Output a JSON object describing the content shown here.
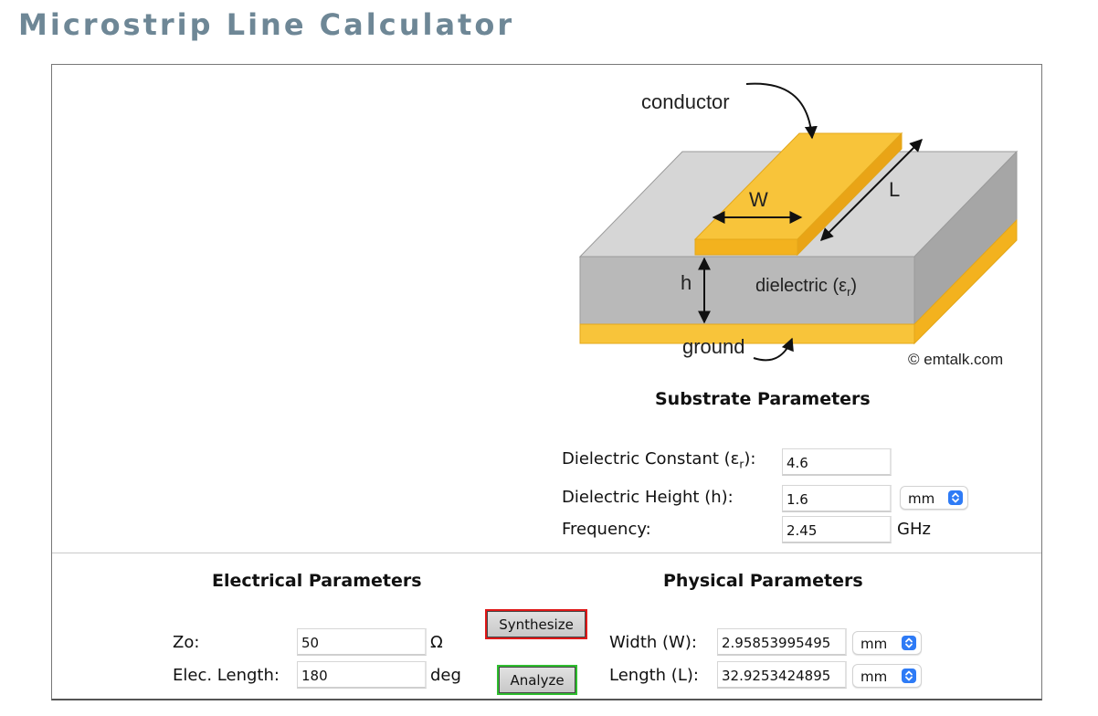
{
  "page": {
    "title": "Microstrip Line Calculator"
  },
  "diagram": {
    "conductor_label": "conductor",
    "width_label": "W",
    "length_label": "L",
    "height_label": "h",
    "dielectric_label": "dielectric (ε",
    "dielectric_sub": "r",
    "dielectric_close": ")",
    "ground_label": "ground",
    "copyright": "© emtalk.com"
  },
  "substrate": {
    "heading": "Substrate Parameters",
    "dielectric_constant": {
      "label_pre": "Dielectric Constant (ε",
      "label_sub": "r",
      "label_post": "):",
      "value": "4.6"
    },
    "dielectric_height": {
      "label": "Dielectric Height (h):",
      "value": "1.6",
      "unit": "mm"
    },
    "frequency": {
      "label": "Frequency:",
      "value": "2.45",
      "unit": "GHz"
    }
  },
  "electrical": {
    "heading": "Electrical Parameters",
    "zo": {
      "label": "Zo:",
      "value": "50",
      "unit": "Ω"
    },
    "elec_length": {
      "label": "Elec. Length:",
      "value": "180",
      "unit": "deg"
    }
  },
  "actions": {
    "synthesize": "Synthesize",
    "analyze": "Analyze"
  },
  "physical": {
    "heading": "Physical Parameters",
    "width": {
      "label": "Width (W):",
      "value": "2.95853995495",
      "unit": "mm"
    },
    "length": {
      "label": "Length (L):",
      "value": "32.9253424895",
      "unit": "mm"
    }
  },
  "colors": {
    "title": "#6e8796",
    "conductor": "#f8c43a",
    "dielectric_front": "#b9b9b9",
    "dielectric_top": "#d6d6d6",
    "synthesize_border": "#e01818",
    "analyze_border": "#2fbe2f",
    "select_chevron": "#2e7bf6"
  },
  "icons": {
    "select_chevron": "chevron-updown-icon"
  }
}
